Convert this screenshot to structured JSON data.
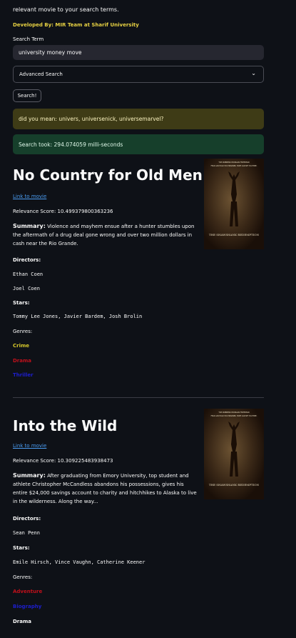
{
  "header": {
    "intro": "relevant movie to your search terms.",
    "developed_by": "Developed By: MIR Team at Sharif University",
    "search_label": "Search Term",
    "search_value": "university money move",
    "advanced_label": "Advanced Search",
    "search_button": "Search!",
    "did_you_mean": "did you mean: univers, universenick, universemarvel?",
    "search_time": "Search took: 294.074059 milli-seconds"
  },
  "labels": {
    "link": "Link to movie",
    "summary": "Summary:",
    "directors": "Directors:",
    "stars": "Stars:",
    "genres": "Genres:"
  },
  "movies": [
    {
      "title": "No Country for Old Men",
      "relevance": "Relevance Score: 10.499379800363236",
      "summary": "Violence and mayhem ensue after a hunter stumbles upon the aftermath of a drug deal gone wrong and over two million dollars in cash near the Rio Grande.",
      "directors": [
        "Ethan Coen",
        "Joel Coen"
      ],
      "stars": "Tommy Lee Jones, Javier Bardem, Josh Brolin",
      "genres": [
        {
          "name": "Crime",
          "color": "#d4c62a"
        },
        {
          "name": "Drama",
          "color": "#c0101b"
        },
        {
          "name": "Thriller",
          "color": "#1d1ecc"
        }
      ],
      "poster": {
        "top_text": "TIM ROBBINS   MORGAN FREEMAN",
        "tagline": "FEAR CAN HOLD YOU PRISONER. HOPE CAN SET YOU FREE.",
        "name": "THE SHAWSHANK REDEMPTION"
      }
    },
    {
      "title": "Into the Wild",
      "relevance": "Relevance Score: 10.309225483938473",
      "summary": "After graduating from Emory University, top student and athlete Christopher McCandless abandons his possessions, gives his entire $24,000 savings account to charity and hitchhikes to Alaska to live in the wilderness. Along the way...",
      "directors": [
        "Sean Penn"
      ],
      "stars": "Emile Hirsch, Vince Vaughn, Catherine Keener",
      "genres": [
        {
          "name": "Adventure",
          "color": "#c0101b"
        },
        {
          "name": "Biography",
          "color": "#1d1ecc"
        },
        {
          "name": "Drama",
          "color": "#fafafa"
        }
      ],
      "poster": {
        "top_text": "TIM ROBBINS   MORGAN FREEMAN",
        "tagline": "FEAR CAN HOLD YOU PRISONER. HOPE CAN SET YOU FREE.",
        "name": "THE SHAWSHANK REDEMPTION"
      }
    }
  ]
}
